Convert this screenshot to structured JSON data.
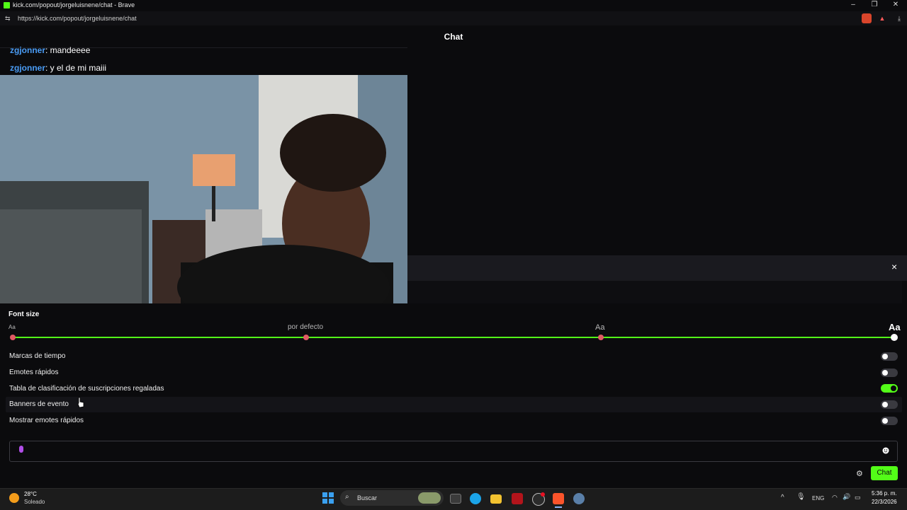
{
  "window": {
    "title": "kick.com/popout/jorgeluisnene/chat - Brave",
    "url": "https://kick.com/popout/jorgeluisnene/chat",
    "controls": {
      "minimize": "–",
      "restore": "❐",
      "close": "✕"
    }
  },
  "chat": {
    "header": "Chat",
    "messages": [
      {
        "user": "zgjonner",
        "text": ": mandeeee"
      },
      {
        "user": "zgjonner",
        "text": ": y el de mi maiii"
      }
    ],
    "input_placeholder": "",
    "send_label": "Chat"
  },
  "settings": {
    "close": "×",
    "font_size": {
      "title": "Font size",
      "ticks": [
        "Aa",
        "por defecto",
        "Aa",
        "Aa"
      ],
      "selected_index": 3
    },
    "toggles": [
      {
        "label": "Marcas de tiempo",
        "on": false
      },
      {
        "label": "Emotes rápidos",
        "on": false
      },
      {
        "label": "Tabla de clasificación de suscripciones regaladas",
        "on": true
      },
      {
        "label": "Banners de evento",
        "on": false
      },
      {
        "label": "Mostrar emotes rápidos",
        "on": false
      }
    ]
  },
  "taskbar": {
    "weather_temp": "28°C",
    "weather_desc": "Soleado",
    "search_label": "Buscar",
    "lang": "ENG",
    "time": "5:36 p. m.",
    "date": "22/3/2026"
  },
  "colors": {
    "accent": "#53fc18",
    "username": "#4a9cf5",
    "slider_dot": "#e05a63"
  }
}
